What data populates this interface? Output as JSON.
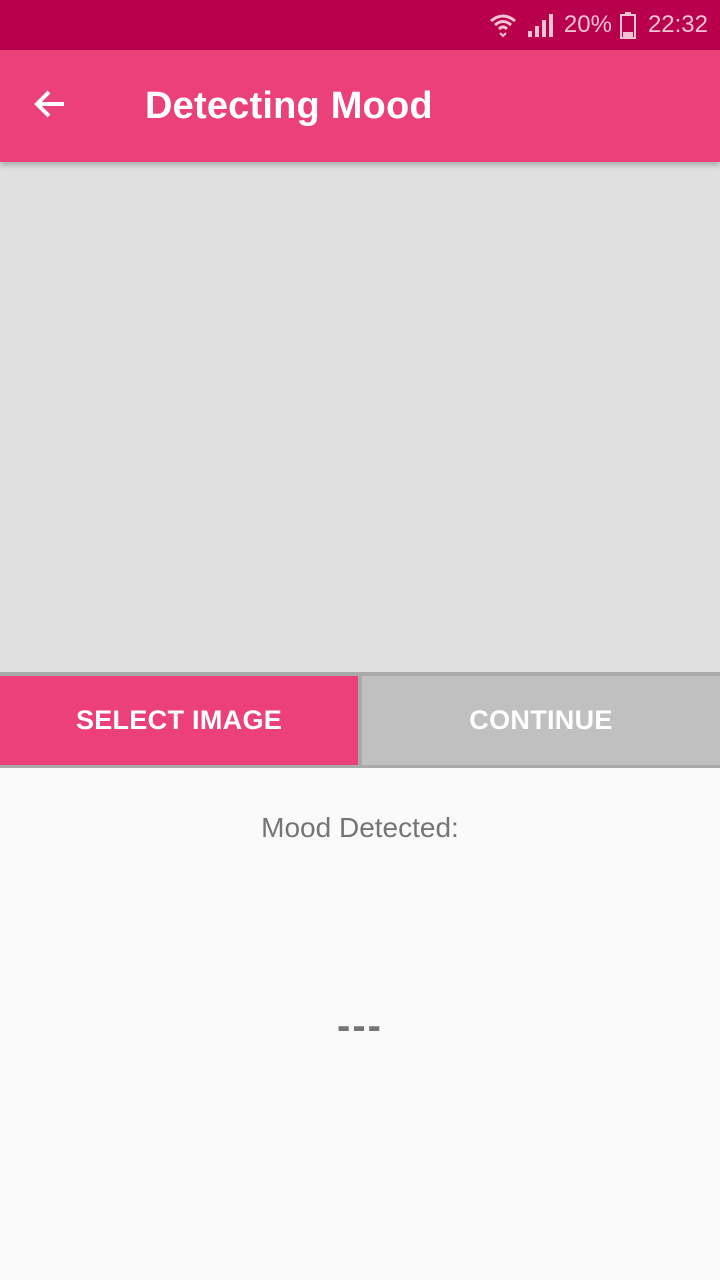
{
  "status_bar": {
    "battery_percent": "20%",
    "time": "22:32",
    "icons": [
      "wifi-icon",
      "signal-icon",
      "battery-icon"
    ]
  },
  "app_bar": {
    "title": "Detecting Mood",
    "back_icon": "arrow-left-icon"
  },
  "actions": {
    "select_label": "SELECT IMAGE",
    "continue_label": "CONTINUE"
  },
  "result": {
    "label": "Mood Detected:",
    "value": "---"
  },
  "colors": {
    "status_bar": "#b8004c",
    "primary": "#ec407a",
    "disabled_button": "#c0c0c0",
    "image_placeholder": "#e0e0e0",
    "text_secondary": "#757575"
  }
}
